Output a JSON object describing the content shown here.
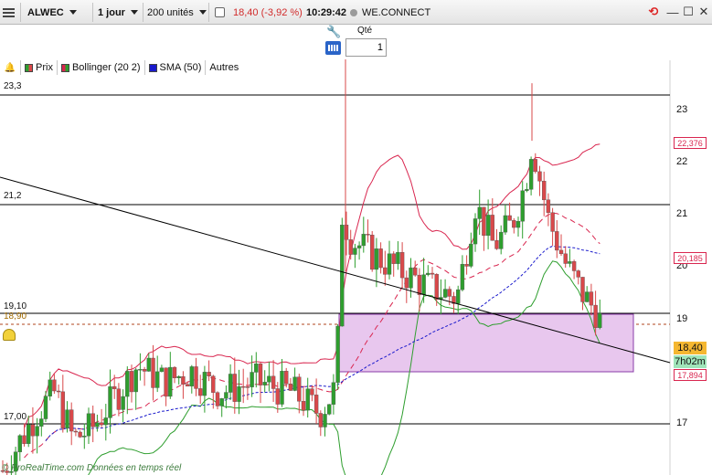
{
  "toolbar": {
    "symbol": "ALWEC",
    "timeframe": "1 jour",
    "units": "200 unités",
    "last_price": "18,40",
    "change": "(-3,92 %)",
    "time": "10:29:42",
    "instrument": "WE.CONNECT"
  },
  "order": {
    "qty_label": "Qté",
    "qty_value": "1"
  },
  "legend": {
    "price": "Prix",
    "bollinger": "Bollinger (20 2)",
    "sma": "SMA (50)",
    "others": "Autres"
  },
  "left_labels": {
    "top": "23,3",
    "mid": "21,2",
    "upper_level": "19,10",
    "current": "18,90",
    "low": "17,00"
  },
  "axis": {
    "l23": "23",
    "l22": "22",
    "l21": "21",
    "l20": "20",
    "l19": "19",
    "l17": "17"
  },
  "right_tags": {
    "bb_upper": "22,376",
    "sma_value": "20,185",
    "last": "18,40",
    "countdown": "7h02m",
    "bb_lower": "17,894"
  },
  "watermark": "© ProRealTime.com Données en temps réel",
  "colors": {
    "up": "#2e9e2e",
    "down": "#d9484a",
    "bollinger": "#d9264f",
    "sma": "#1a1acc",
    "zone_fill": "#e8c7ee",
    "zone_border": "#8a3ca8",
    "support_line": "#000000"
  }
}
